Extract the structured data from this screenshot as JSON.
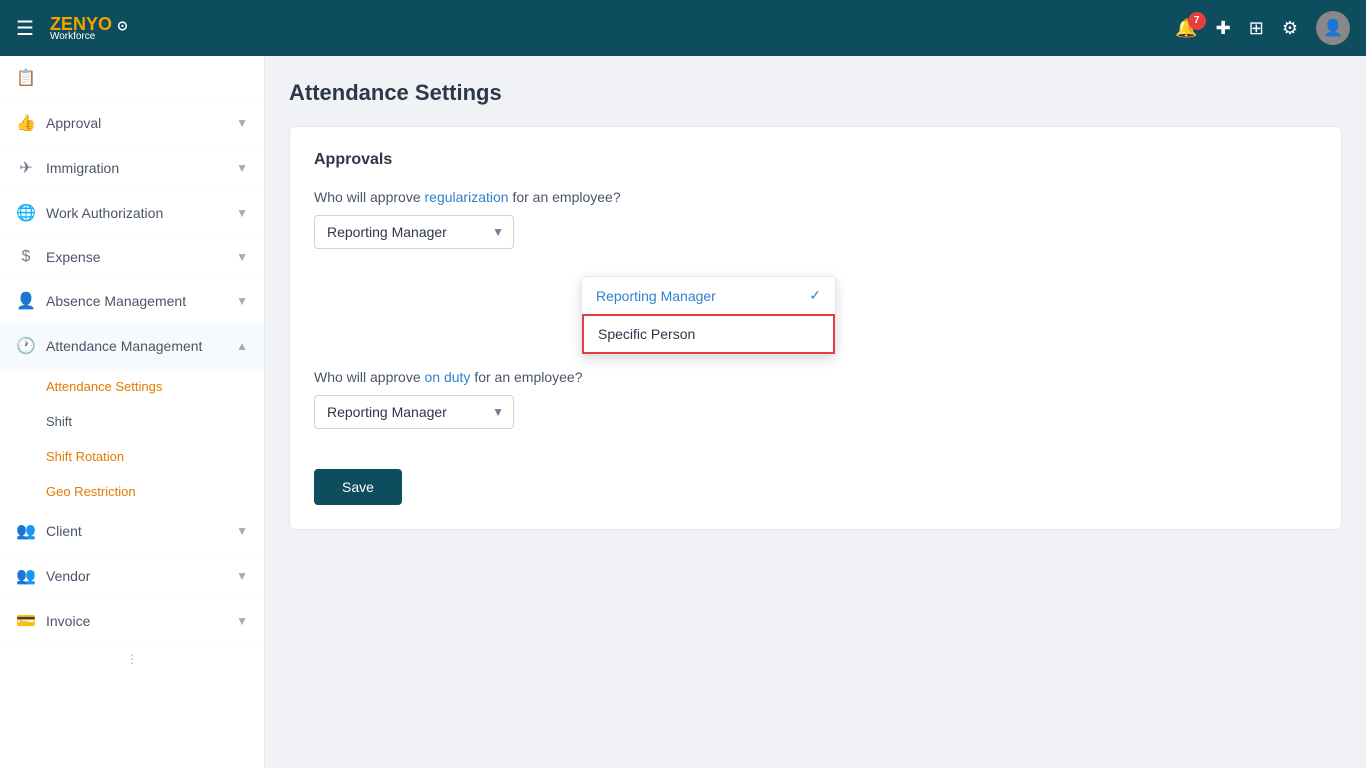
{
  "app": {
    "name": "ZENYO",
    "sub": "Workforce",
    "notification_count": "7"
  },
  "topnav": {
    "hamburger": "☰",
    "bell_label": "notifications",
    "plus_label": "add",
    "grid_label": "apps",
    "gear_label": "settings"
  },
  "sidebar": {
    "items": [
      {
        "id": "approval",
        "label": "Approval",
        "icon": "👍",
        "has_chevron": true
      },
      {
        "id": "immigration",
        "label": "Immigration",
        "icon": "✈️",
        "has_chevron": true
      },
      {
        "id": "work-authorization",
        "label": "Work Authorization",
        "icon": "🌐",
        "has_chevron": true
      },
      {
        "id": "expense",
        "label": "Expense",
        "icon": "$",
        "has_chevron": true
      },
      {
        "id": "absence-management",
        "label": "Absence Management",
        "icon": "👤",
        "has_chevron": true
      },
      {
        "id": "attendance-management",
        "label": "Attendance Management",
        "icon": "🕐",
        "has_chevron": true,
        "expanded": true
      }
    ],
    "attendance_sub_items": [
      {
        "id": "attendance-settings",
        "label": "Attendance Settings",
        "active": true
      },
      {
        "id": "shift",
        "label": "Shift",
        "active": false
      },
      {
        "id": "shift-rotation",
        "label": "Shift Rotation",
        "active": false
      },
      {
        "id": "geo-restriction",
        "label": "Geo Restriction",
        "active": false
      }
    ],
    "bottom_items": [
      {
        "id": "client",
        "label": "Client",
        "icon": "👥",
        "has_chevron": true
      },
      {
        "id": "vendor",
        "label": "Vendor",
        "icon": "👥",
        "has_chevron": true
      },
      {
        "id": "invoice",
        "label": "Invoice",
        "icon": "💳",
        "has_chevron": true
      }
    ]
  },
  "main": {
    "page_title": "Attendance Settings",
    "card": {
      "section_title": "Approvals",
      "field1": {
        "label_normal": "Who will approve ",
        "label_highlight": "regularization",
        "label_end": " for an employee?",
        "selected": "Reporting Manager",
        "placeholder": "Reporting Manager"
      },
      "field2": {
        "label_prefix": "Who will approve ",
        "label_highlight": "on duty",
        "label_end": " for an employee?",
        "selected": "Reporting Manager",
        "placeholder": "Reporting Manager"
      },
      "save_button": "Save"
    }
  },
  "dropdown": {
    "items": [
      {
        "id": "reporting-manager",
        "label": "Reporting Manager",
        "selected": true
      },
      {
        "id": "specific-person",
        "label": "Specific Person",
        "selected": false,
        "highlighted": true
      }
    ]
  }
}
